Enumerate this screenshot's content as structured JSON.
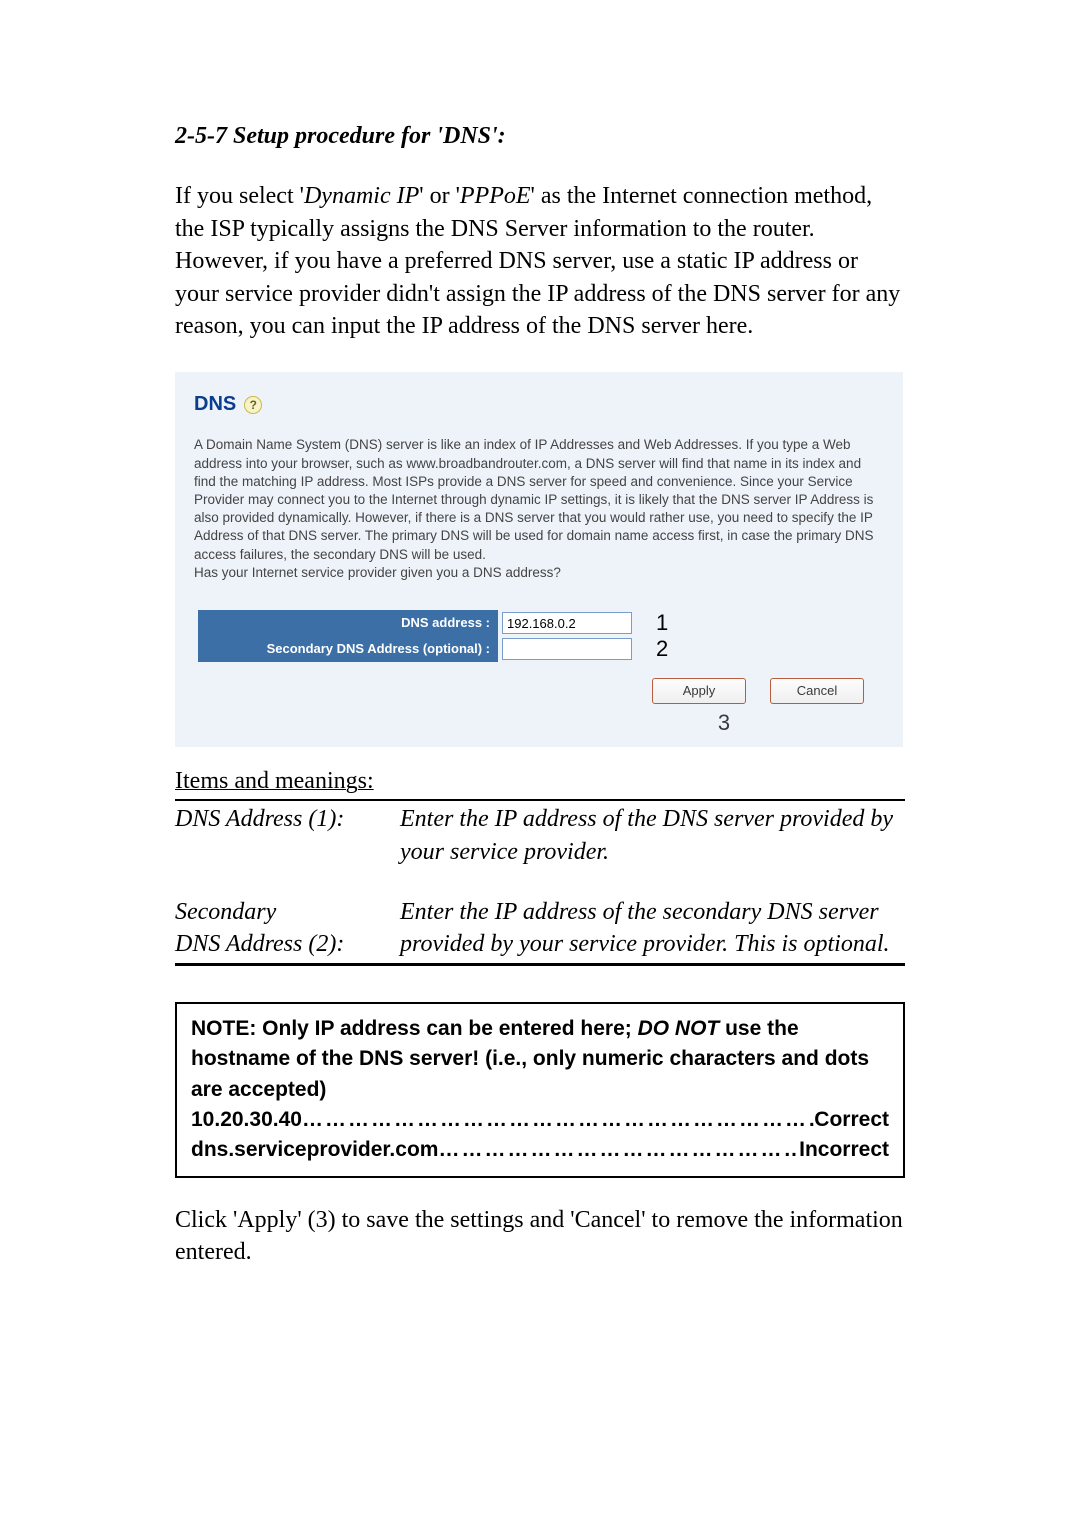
{
  "heading": "2-5-7 Setup procedure for 'DNS':",
  "intro": {
    "segments": [
      "If you select '",
      "Dynamic IP",
      "' or '",
      "PPPoE",
      "' as the Internet connection method, the ISP typically assigns the DNS Server information to the router. However, if you have a preferred DNS server, use a static IP address or your service provider didn't assign the IP address of the DNS server for any reason, you can input the IP address of the DNS server here."
    ]
  },
  "screenshot": {
    "title": "DNS",
    "help_symbol": "?",
    "description": "A Domain Name System (DNS) server is like an index of IP Addresses and Web Addresses. If you type a Web address into your browser, such as www.broadbandrouter.com, a DNS server will find that name in its index and find the matching IP address. Most ISPs provide a DNS server for speed and convenience. Since your Service Provider may connect you to the Internet through dynamic IP settings, it is likely that the DNS server IP Address is also provided dynamically. However, if there is a DNS server that you would rather use, you need to specify the IP Address of that DNS server. The primary DNS will be used for domain name access first, in case the primary DNS access failures, the secondary DNS will be used.",
    "question": "Has your Internet service provider given you a DNS address?",
    "fields": {
      "dns_label": "DNS address :",
      "dns_value": "192.168.0.2",
      "dns_num": "1",
      "secondary_label": "Secondary DNS Address (optional) :",
      "secondary_value": "",
      "secondary_num": "2"
    },
    "buttons": {
      "apply": "Apply",
      "cancel": "Cancel",
      "num": "3"
    }
  },
  "items": {
    "heading": "Items and meanings:",
    "rows": [
      {
        "term": "DNS Address (1):",
        "def": "Enter the IP address of the DNS server provided by your service provider."
      },
      {
        "term": "Secondary\nDNS Address (2):",
        "def": "Enter the IP address of the secondary DNS server provided by your service provider. This is optional."
      }
    ]
  },
  "note": {
    "line1_part1": "NOTE: Only IP address can be entered here; ",
    "line1_part2": "DO NOT",
    "line1_part3": " use the hostname of the DNS server! (i.e., only numeric characters and dots are accepted)",
    "ex1_left": "10.20.30.40",
    "ex1_right": "Correct",
    "ex2_left": "dns.serviceprovider.com",
    "ex2_right": "Incorrect",
    "dots1": "……………………………………………………………………",
    "dots2": "…………………………………………..."
  },
  "closing": "Click 'Apply' (3) to save the settings and 'Cancel' to remove the information entered."
}
